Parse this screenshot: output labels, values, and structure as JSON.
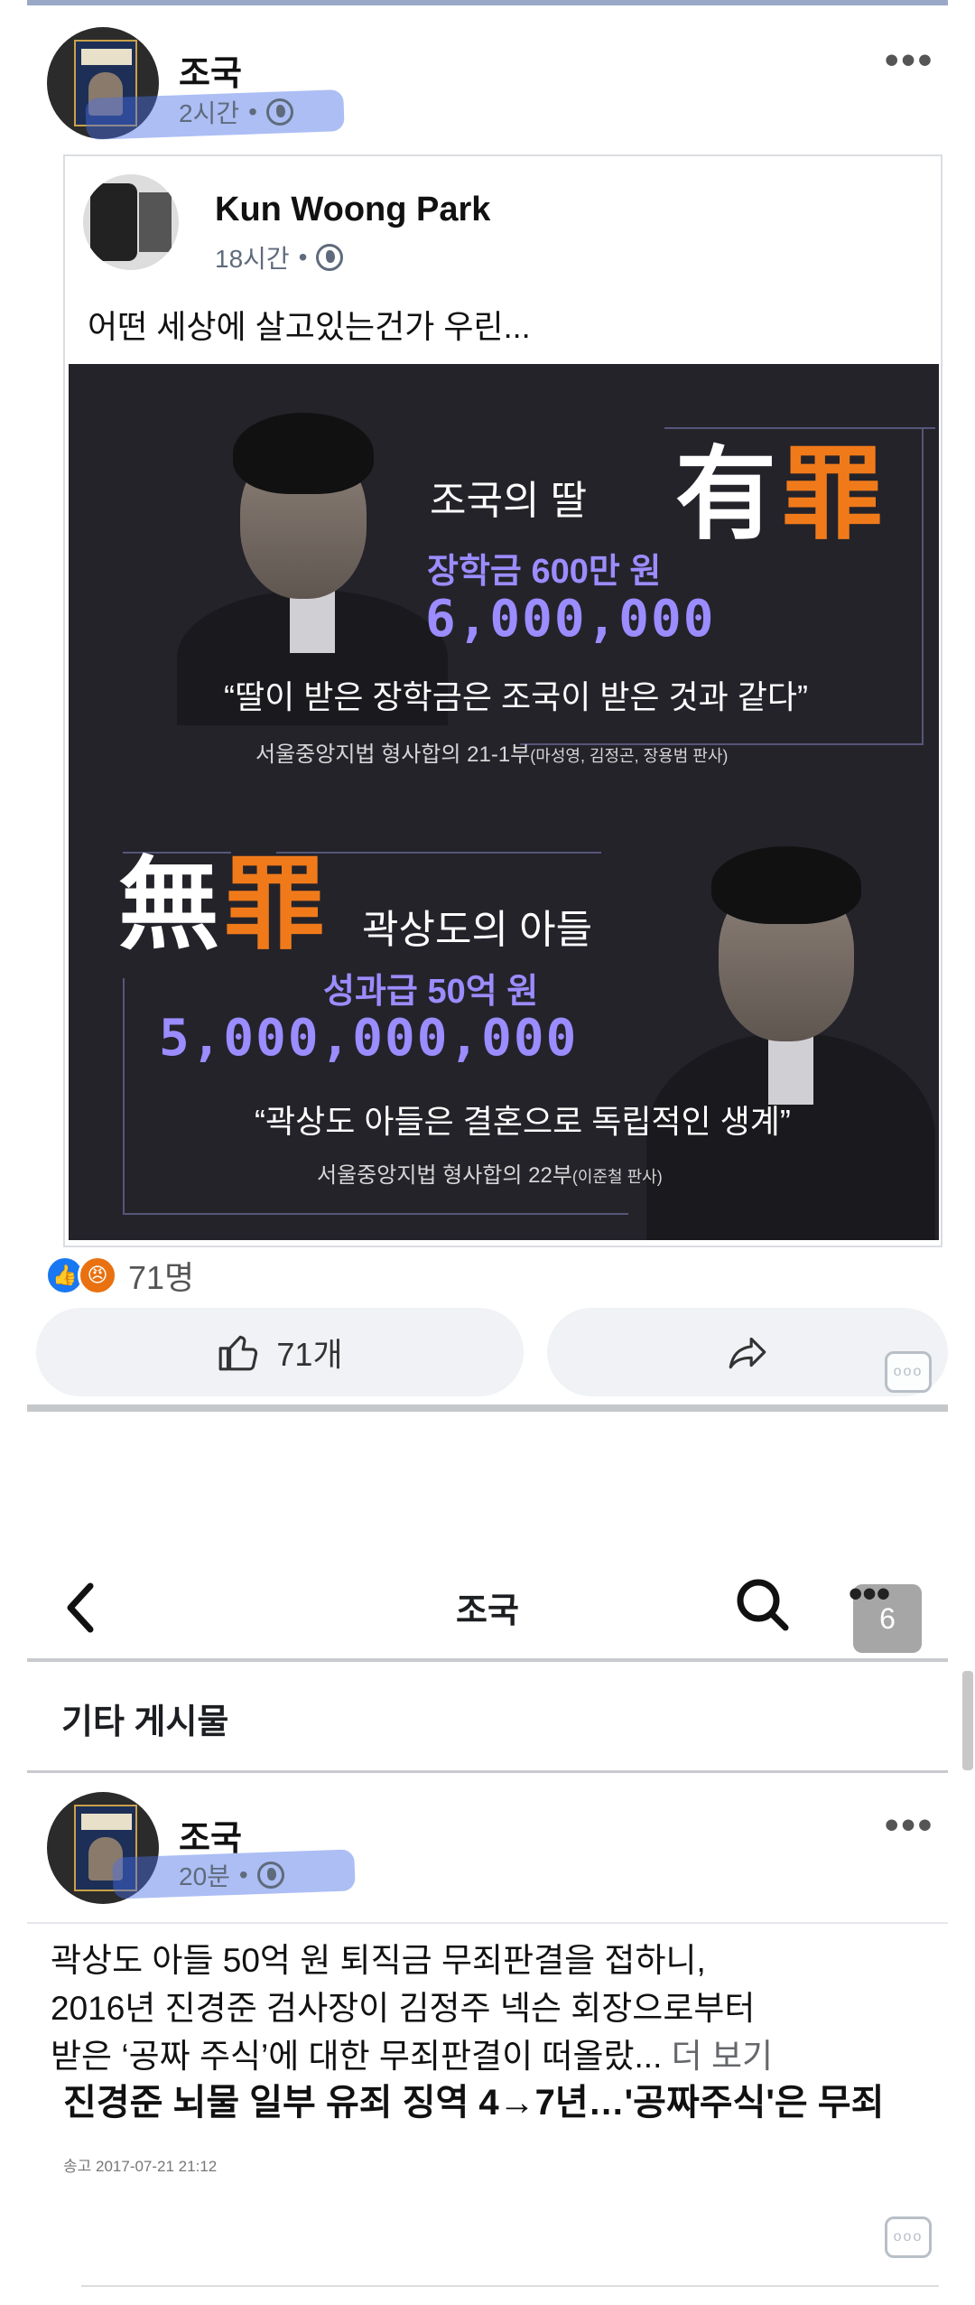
{
  "post1": {
    "author": "조국",
    "time": "2시간",
    "separator": "•",
    "shared": {
      "author": "Kun Woong Park",
      "time": "18시간",
      "separator": "•",
      "text": "어떤 세상에 살고있는건가 우린...",
      "infographic": {
        "top": {
          "hanja_1": "有",
          "hanja_2": "罪",
          "subject": "조국의 딸",
          "item": "장학금 600만 원",
          "amount": "6,000,000",
          "quote": "“딸이 받은 장학금은 조국이 받은 것과 같다”",
          "court": "서울중앙지법 형사합의 21-1부",
          "judges": "(마성영, 김정곤, 장용범 판사)"
        },
        "bottom": {
          "hanja_1": "無",
          "hanja_2": "罪",
          "subject": "곽상도의 아들",
          "item": "성과급 50억 원",
          "amount": "5,000,000,000",
          "quote": "“곽상도 아들은 결혼으로 독립적인 생계”",
          "court": "서울중앙지법 형사합의 22부",
          "judges": "(이준철 판사)"
        }
      }
    },
    "reaction_count": "71명",
    "like_label": "71개",
    "colors": {
      "like": "#1877f2",
      "angry": "#e9710f",
      "highlight": "#466ee6",
      "orange": "#f07a1a",
      "purple": "#9b8cff"
    }
  },
  "nav": {
    "title": "조국",
    "tab_count": "6"
  },
  "section_title": "기타 게시물",
  "post2": {
    "author": "조국",
    "time": "20분",
    "separator": "•",
    "lines": [
      "곽상도 아들 50억 원 퇴직금 무죄판결을 접하니,",
      "2016년 진경준 검사장이 김정주 넥슨 회장으로부터",
      "받은 ‘공짜 주식’에 대한 무죄판결이 떠올랐... "
    ],
    "see_more": "더 보기",
    "article": {
      "title": "진경준 뇌물 일부 유죄 징역 4→7년…'공짜주식'은 무죄",
      "date": "송고 2017-07-21 21:12"
    }
  },
  "icons": {
    "more": "more-dots-icon",
    "globe": "globe-icon",
    "back": "back-arrow-icon",
    "search": "search-icon",
    "like": "thumbs-up-icon",
    "share": "share-arrow-icon",
    "comment": "comment-bubble-icon"
  }
}
